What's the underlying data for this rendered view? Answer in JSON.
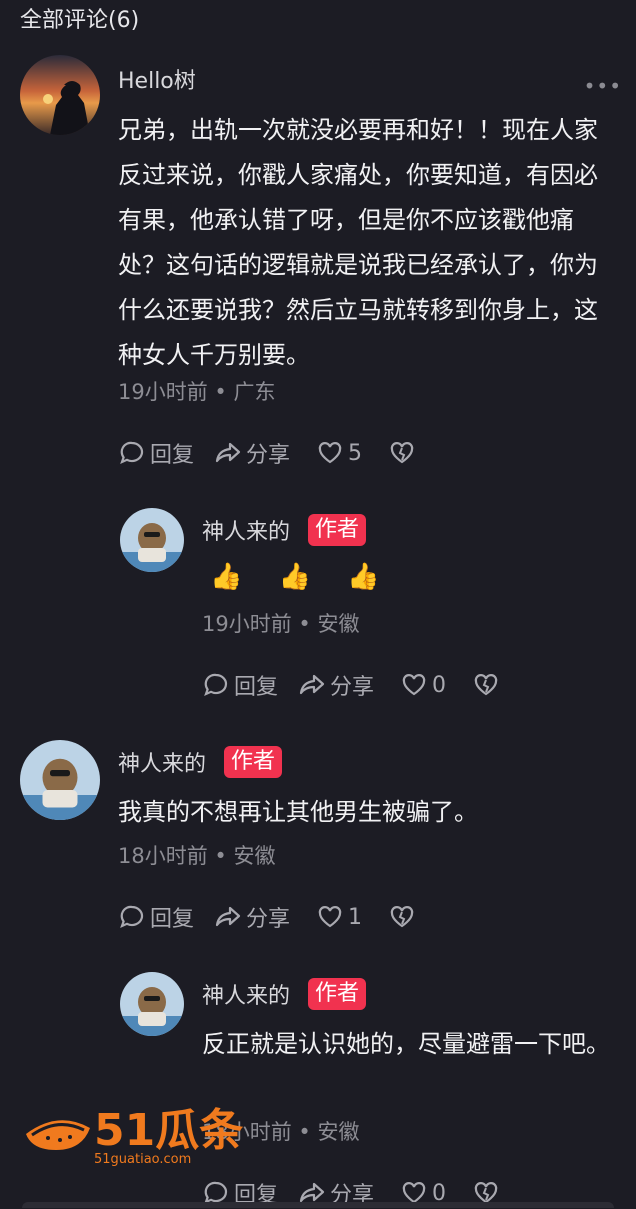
{
  "header": {
    "title": "全部评论(6)"
  },
  "comments": [
    {
      "author": "Hello树",
      "text": "兄弟，出轨一次就没必要再和好！！现在人家反过来说，你戳人家痛处，你要知道，有因必有果，他承认错了呀，但是你不应该戳他痛处？这句话的逻辑就是说我已经承认了，你为什么还要说我？然后立马就转移到你身上，这种女人千万别要。",
      "meta": "19小时前 • 广东",
      "more": "•••",
      "reply_label": "回复",
      "share_label": "分享",
      "likes": "5"
    },
    {
      "author": "神人来的",
      "badge": "作者",
      "text": "👍 👍 👍",
      "meta": "19小时前 • 安徽",
      "reply_label": "回复",
      "share_label": "分享",
      "likes": "0"
    },
    {
      "author": "神人来的",
      "badge": "作者",
      "text": "我真的不想再让其他男生被骗了。",
      "meta": "18小时前 • 安徽",
      "reply_label": "回复",
      "share_label": "分享",
      "likes": "1"
    },
    {
      "author": "神人来的",
      "badge": "作者",
      "text": "反正就是认识她的，尽量避雷一下吧。",
      "meta": "18小时前 • 安徽",
      "reply_label": "回复",
      "share_label": "分享",
      "likes": "0"
    }
  ],
  "watermark": {
    "logo_text": "51瓜条",
    "url": "51guatiao.com"
  },
  "colors": {
    "background": "#1c1c24",
    "badge": "#f1324f",
    "watermark": "#f07a1e"
  }
}
